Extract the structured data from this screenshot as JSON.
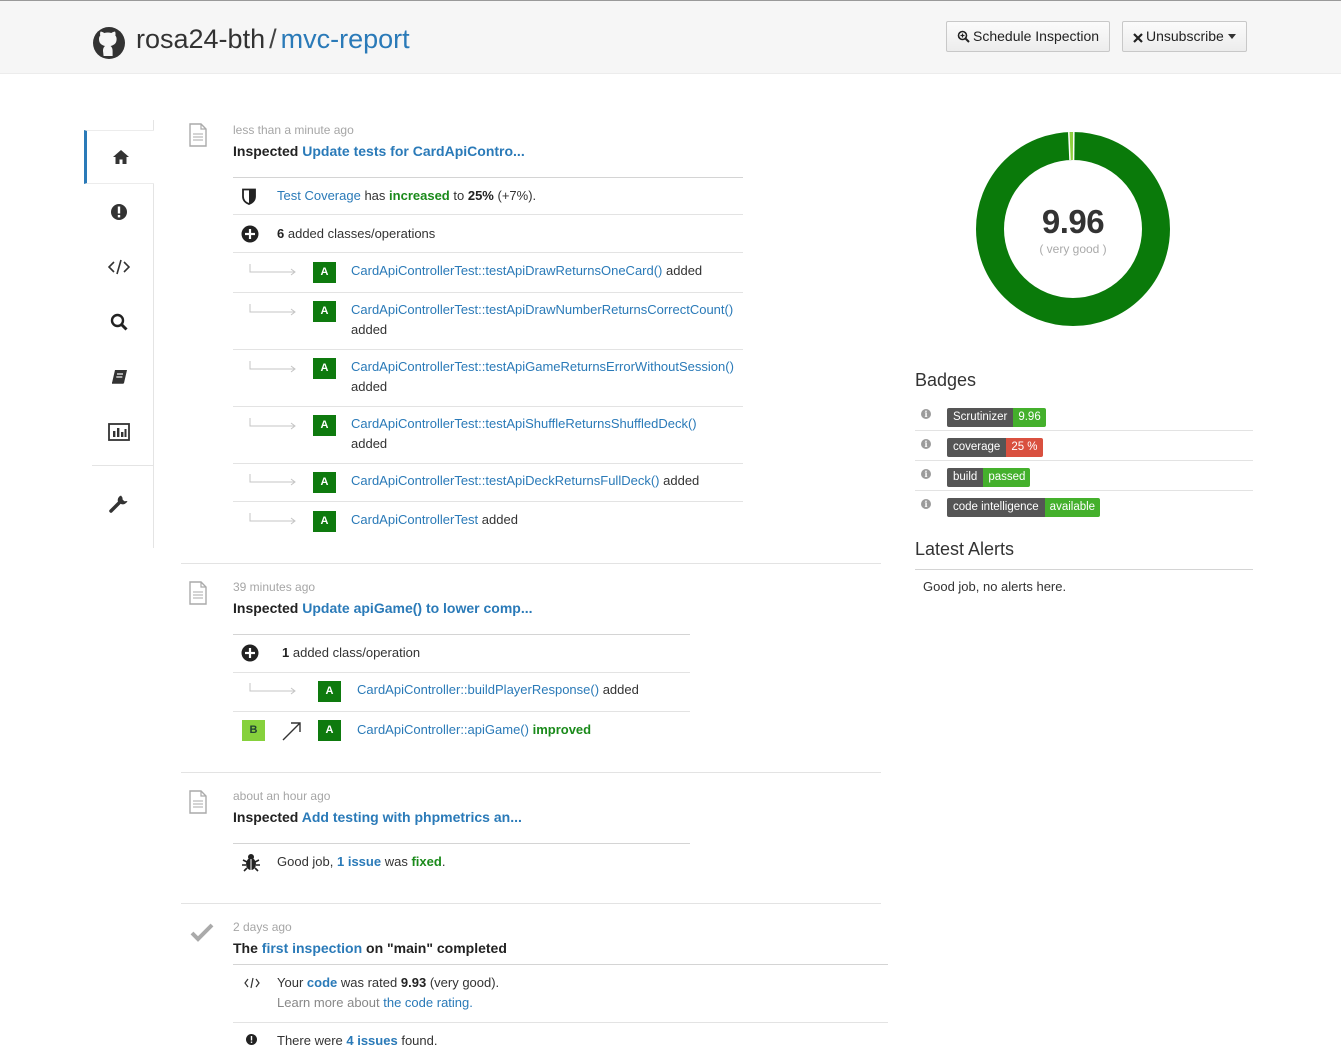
{
  "header": {
    "owner": "rosa24-bth",
    "separator": "/",
    "repo": "mvc-report",
    "schedule_label": "Schedule Inspection",
    "unsubscribe_label": "Unsubscribe"
  },
  "sidenav": [
    "home-icon",
    "alert-icon",
    "code-icon",
    "search-icon",
    "book-icon",
    "chart-icon",
    "wrench-icon"
  ],
  "events": [
    {
      "time": "less than a minute ago",
      "prefix": "Inspected",
      "link": "Update tests for CardApiContro...",
      "coverage": {
        "link": "Test Coverage",
        "mid1": "has",
        "word": "increased",
        "mid2": "to",
        "value": "25%",
        "delta": "(+7%)."
      },
      "added": {
        "count": "6",
        "text": "added classes/operations"
      },
      "items": [
        {
          "grade": "A",
          "link": "CardApiControllerTest::testApiDrawReturnsOneCard()",
          "suffix": "added"
        },
        {
          "grade": "A",
          "link": "CardApiControllerTest::testApiDrawNumberReturnsCorrectCount()",
          "suffix": "added"
        },
        {
          "grade": "A",
          "link": "CardApiControllerTest::testApiGameReturnsErrorWithoutSession()",
          "suffix": "added"
        },
        {
          "grade": "A",
          "link": "CardApiControllerTest::testApiShuffleReturnsShuffledDeck()",
          "suffix": "added"
        },
        {
          "grade": "A",
          "link": "CardApiControllerTest::testApiDeckReturnsFullDeck()",
          "suffix": "added"
        },
        {
          "grade": "A",
          "link": "CardApiControllerTest",
          "suffix": "added"
        }
      ]
    },
    {
      "time": "39 minutes ago",
      "prefix": "Inspected",
      "link": "Update apiGame() to lower comp...",
      "added": {
        "count": "1",
        "text": "added class/operation"
      },
      "items": [
        {
          "grade": "A",
          "link": "CardApiController::buildPlayerResponse()",
          "suffix": "added"
        },
        {
          "from": "B",
          "grade": "A",
          "link": "CardApiController::apiGame()",
          "suffix": "improved"
        }
      ]
    },
    {
      "time": "about an hour ago",
      "prefix": "Inspected",
      "link": "Add testing with phpmetrics an...",
      "fixed": {
        "pre": "Good job,",
        "link": "1 issue",
        "mid": "was",
        "word": "fixed",
        "post": "."
      }
    },
    {
      "time": "2 days ago",
      "title_pre": "The",
      "link": "first inspection",
      "title_post": "on \"main\" completed",
      "rating": {
        "pre": "Your",
        "link": "code",
        "mid": "was rated",
        "value": "9.93",
        "post": "(very good).",
        "learn_pre": "Learn more about",
        "learn_link": "the code rating."
      },
      "issues": {
        "pre": "There were",
        "link": "4 issues",
        "post": "found."
      }
    }
  ],
  "score": {
    "value": "9.96",
    "label": "( very good )",
    "fraction": 0.9
  },
  "badges_title": "Badges",
  "badges": [
    {
      "left": "Scrutinizer",
      "right": "9.96",
      "color": "#44b02c"
    },
    {
      "left": "coverage",
      "right": "25 %",
      "color": "#d9503f"
    },
    {
      "left": "build",
      "right": "passed",
      "color": "#44b02c"
    },
    {
      "left": "code intelligence",
      "right": "available",
      "color": "#44b02c"
    }
  ],
  "alerts_title": "Latest Alerts",
  "alerts_text": "Good job, no alerts here."
}
